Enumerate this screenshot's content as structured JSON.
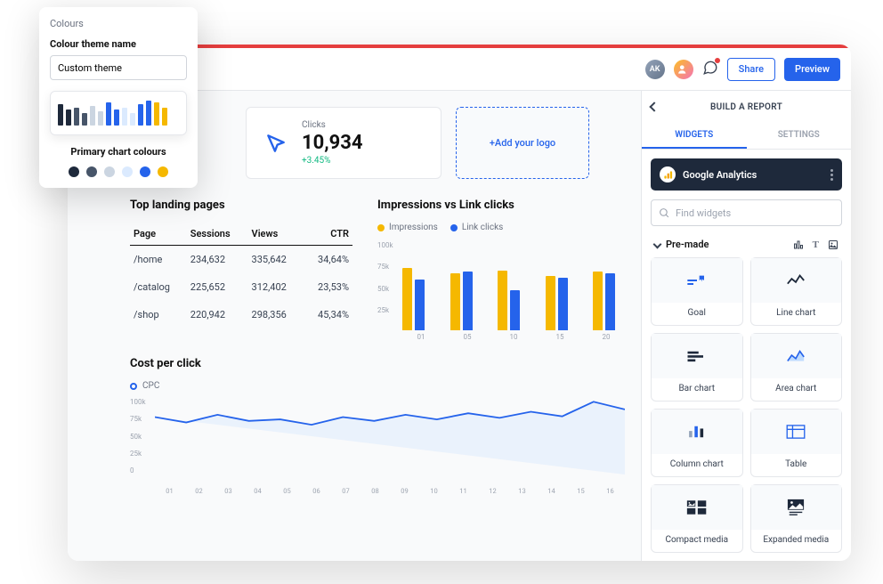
{
  "topbar": {
    "avatar1_initials": "AK",
    "share_label": "Share",
    "preview_label": "Preview"
  },
  "stats": {
    "clicks_label": "Clicks",
    "clicks_value": "10,934",
    "clicks_delta": "+3.45%",
    "add_logo": "+Add your logo"
  },
  "landing": {
    "title": "Top landing pages",
    "headers": [
      "Page",
      "Sessions",
      "Views",
      "CTR"
    ],
    "rows": [
      {
        "page": "/home",
        "sessions": "234,632",
        "views": "335,642",
        "ctr": "34,64%"
      },
      {
        "page": "/catalog",
        "sessions": "225,652",
        "views": "312,402",
        "ctr": "23,53%"
      },
      {
        "page": "/shop",
        "sessions": "220,942",
        "views": "298,356",
        "ctr": "45,34%"
      }
    ]
  },
  "impressions": {
    "title": "Impressions vs Link clicks",
    "legend_a": "Impressions",
    "legend_b": "Link clicks"
  },
  "cpc": {
    "title": "Cost per click",
    "legend": "CPC"
  },
  "right": {
    "header": "BUILD A REPORT",
    "tab_widgets": "WIDGETS",
    "tab_settings": "SETTINGS",
    "integration": "Google Analytics",
    "search_placeholder": "Find widgets",
    "section_premade": "Pre-made",
    "widgets": [
      "Goal",
      "Line chart",
      "Bar chart",
      "Area chart",
      "Column chart",
      "Table",
      "Compact media",
      "Expanded media"
    ]
  },
  "colours": {
    "title": "Colours",
    "theme_label": "Colour theme name",
    "theme_value": "Custom theme",
    "primary_label": "Primary chart colours",
    "swatches": [
      "#1e293b",
      "#475569",
      "#cbd5e1",
      "#dbeafe",
      "#2563eb",
      "#f5b800"
    ]
  },
  "chart_data": [
    {
      "type": "bar",
      "title": "Impressions vs Link clicks",
      "categories": [
        "01",
        "05",
        "10",
        "15",
        "20"
      ],
      "series": [
        {
          "name": "Impressions",
          "values": [
            85,
            78,
            82,
            75,
            80
          ]
        },
        {
          "name": "Link clicks",
          "values": [
            70,
            80,
            55,
            72,
            78
          ]
        }
      ],
      "ylabel": "",
      "ylim": [
        0,
        100
      ],
      "yunit": "k",
      "colors": [
        "#f5b800",
        "#2563eb"
      ]
    },
    {
      "type": "area",
      "title": "Cost per click",
      "x": [
        "01",
        "02",
        "03",
        "04",
        "05",
        "06",
        "07",
        "08",
        "09",
        "10",
        "11",
        "12",
        "13",
        "14",
        "15",
        "16"
      ],
      "series": [
        {
          "name": "CPC",
          "values": [
            75,
            68,
            78,
            70,
            72,
            65,
            75,
            70,
            78,
            72,
            80,
            74,
            82,
            76,
            95,
            85
          ]
        }
      ],
      "ylim": [
        0,
        100
      ],
      "yunit": "k",
      "ylabels": [
        "100k",
        "75k",
        "50k",
        "25k",
        "0"
      ],
      "color": "#2563eb"
    }
  ]
}
